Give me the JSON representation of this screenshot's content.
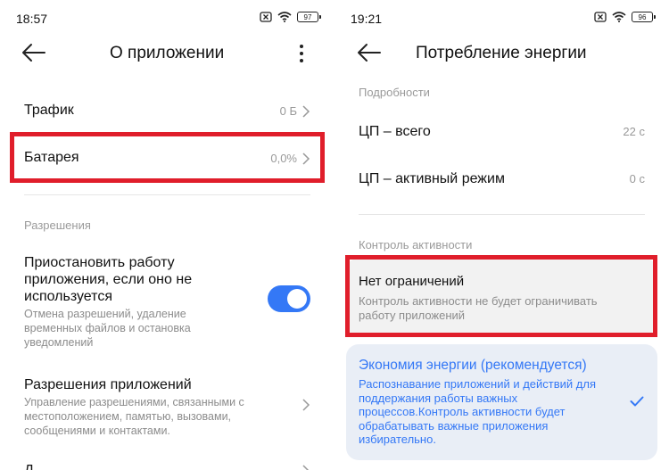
{
  "left": {
    "status": {
      "time": "18:57",
      "battery": "97"
    },
    "title": "О приложении",
    "rows": [
      {
        "label": "Трафик",
        "value": "0 Б"
      },
      {
        "label": "Батарея",
        "value": "0,0%"
      }
    ],
    "permissions_header": "Разрешения",
    "pause": {
      "title": "Приостановить работу приложения, если оно не используется",
      "subtitle": "Отмена разрешений, удаление временных файлов и остановка уведомлений",
      "enabled": true
    },
    "app_perms": {
      "title": "Разрешения приложений",
      "subtitle": "Управление разрешениями, связанными с местоположением, памятью, вызовами, сообщениями и контактами."
    },
    "partial_next_row": "Д"
  },
  "right": {
    "status": {
      "time": "19:21",
      "battery": "96"
    },
    "title": "Потребление энергии",
    "details_header": "Подробности",
    "cpu_rows": [
      {
        "label": "ЦП – всего",
        "value": "22 с"
      },
      {
        "label": "ЦП – активный режим",
        "value": "0 с"
      }
    ],
    "activity_header": "Контроль активности",
    "options": [
      {
        "title": "Нет ограничений",
        "desc": "Контроль активности не будет ограничивать работу приложений",
        "selected": false
      },
      {
        "title": "Экономия энергии (рекомендуется)",
        "desc": "Распознавание приложений и действий для поддержания работы важных процессов.Контроль активности будет обрабатывать важные приложения избирательно.",
        "selected": true
      }
    ]
  },
  "colors": {
    "accent": "#3478f6",
    "highlight": "#e01e2b",
    "muted": "#999999"
  }
}
